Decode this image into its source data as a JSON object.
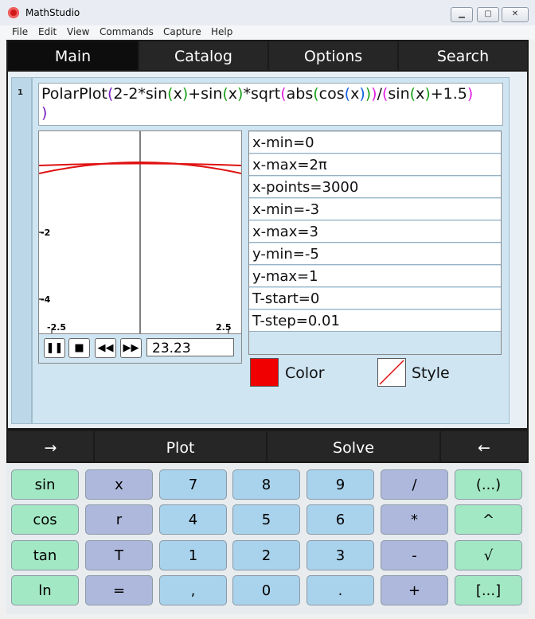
{
  "window": {
    "title": "MathStudio",
    "minimize": "▁",
    "maximize": "▢",
    "close": "✕"
  },
  "menu": [
    "File",
    "Edit",
    "View",
    "Commands",
    "Capture",
    "Help"
  ],
  "tabs": [
    "Main",
    "Catalog",
    "Options",
    "Search"
  ],
  "cell": {
    "number": "1",
    "input_tokens": [
      {
        "t": "PolarPlot",
        "c": "#111111"
      },
      {
        "t": "(",
        "c": "#7a1fc0"
      },
      {
        "t": "2-2*sin",
        "c": "#111111"
      },
      {
        "t": "(",
        "c": "#1aa01a"
      },
      {
        "t": "x",
        "c": "#111111"
      },
      {
        "t": ")",
        "c": "#1aa01a"
      },
      {
        "t": "+sin",
        "c": "#111111"
      },
      {
        "t": "(",
        "c": "#1aa01a"
      },
      {
        "t": "x",
        "c": "#111111"
      },
      {
        "t": ")",
        "c": "#1aa01a"
      },
      {
        "t": "*sqrt",
        "c": "#111111"
      },
      {
        "t": "(",
        "c": "#e020e0"
      },
      {
        "t": "abs",
        "c": "#111111"
      },
      {
        "t": "(",
        "c": "#1aa01a"
      },
      {
        "t": "cos",
        "c": "#111111"
      },
      {
        "t": "(",
        "c": "#1060e0"
      },
      {
        "t": "x",
        "c": "#111111"
      },
      {
        "t": ")",
        "c": "#1060e0"
      },
      {
        "t": ")",
        "c": "#1aa01a"
      },
      {
        "t": ")",
        "c": "#e020e0"
      },
      {
        "t": "/",
        "c": "#111111"
      },
      {
        "t": "(",
        "c": "#e020e0"
      },
      {
        "t": "sin",
        "c": "#111111"
      },
      {
        "t": "(",
        "c": "#1aa01a"
      },
      {
        "t": "x",
        "c": "#111111"
      },
      {
        "t": ")",
        "c": "#1aa01a"
      },
      {
        "t": "+1.5",
        "c": "#111111"
      },
      {
        "t": ")",
        "c": "#e020e0"
      }
    ],
    "input_line2": ")",
    "graph": {
      "x_ticks": [
        "-2.5",
        "2.5"
      ],
      "y_ticks": [
        "-2",
        "-4"
      ],
      "curve_color": "#e01010",
      "xlim": [
        -2.5,
        2.5
      ],
      "ylim": [
        -5,
        1
      ]
    },
    "time_value": "23.23",
    "params": [
      "x-min=0",
      "x-max=2π",
      "x-points=3000",
      "x-min=-3",
      "x-max=3",
      "y-min=-5",
      "y-max=1",
      "T-start=0",
      "T-step=0.01"
    ],
    "color_label": "Color",
    "color_value": "#f00000",
    "style_label": "Style"
  },
  "actions": [
    "→",
    "Plot",
    "Solve",
    "←"
  ],
  "keypad": [
    [
      "sin",
      "x",
      "7",
      "8",
      "9",
      "/",
      "(...)"
    ],
    [
      "cos",
      "r",
      "4",
      "5",
      "6",
      "*",
      "^"
    ],
    [
      "tan",
      "T",
      "1",
      "2",
      "3",
      "-",
      "√"
    ],
    [
      "ln",
      "=",
      ",",
      "0",
      ".",
      "+",
      "[...]"
    ]
  ]
}
